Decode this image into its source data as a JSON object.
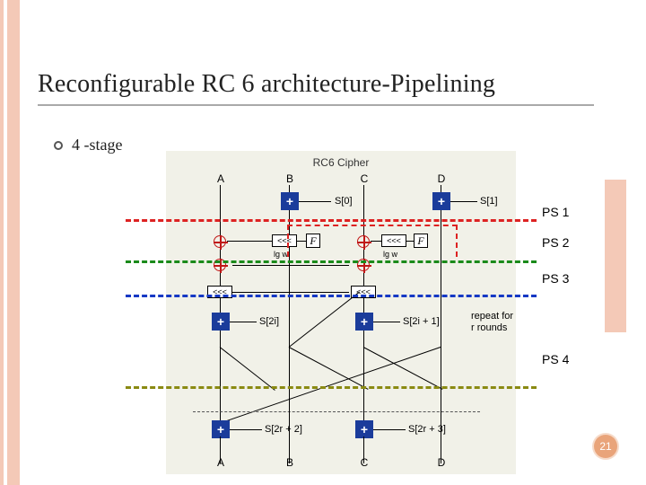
{
  "slide": {
    "title": "Reconfigurable RC 6 architecture-Pipelining",
    "bullet": "4 -stage",
    "page_number": "21"
  },
  "diagram": {
    "title": "RC6 Cipher",
    "top_labels": {
      "a": "A",
      "b": "B",
      "c": "C",
      "d": "D"
    },
    "bottom_labels": {
      "a": "A",
      "b": "B",
      "c": "C",
      "d": "D"
    },
    "skeys": {
      "s0": "S[0]",
      "s1": "S[1]",
      "s2i": "S[2i]",
      "s2i1": "S[2i + 1]",
      "s2r2": "S[2r + 2]",
      "s2r3": "S[2r + 3]"
    },
    "f_label": "F",
    "shift_label": "<<<",
    "lgw": "lg w",
    "repeat_text": "repeat for r rounds",
    "plus": "+"
  },
  "stages": {
    "ps1": "PS 1",
    "ps2": "PS 2",
    "ps3": "PS 3",
    "ps4": "PS 4"
  }
}
